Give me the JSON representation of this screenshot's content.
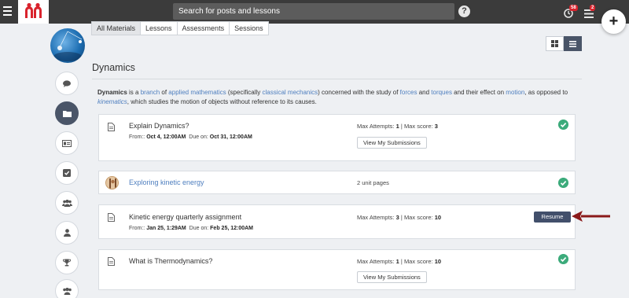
{
  "topbar": {
    "search_placeholder": "Search for posts and lessons",
    "help_glyph": "?",
    "notif_badge": "58",
    "list_badge": "2",
    "add_glyph": "+"
  },
  "tabs": [
    "All Materials",
    "Lessons",
    "Assessments",
    "Sessions"
  ],
  "folder": {
    "title": "Dynamics",
    "description": {
      "term": "Dynamics",
      "p1": " is a ",
      "l1": "branch",
      "p2": " of ",
      "l2": "applied mathematics",
      "p3": " (specifically ",
      "l3": "classical mechanics",
      "p4": ") concerned with the study of ",
      "l4": "forces",
      "p5": " and ",
      "l5": "torques",
      "p6": " and their effect on ",
      "l6": "motion",
      "p7": ", as opposed to ",
      "l7": "kinematics",
      "p8": ", which studies the motion of objects without reference to its causes."
    }
  },
  "materials": [
    {
      "title": "Explain Dynamics?",
      "from_label": "From::",
      "from": "Oct 4, 12:00AM",
      "due_label": "Due on:",
      "due": "Oct 31, 12:00AM",
      "attempts_label": "Max Attempts:",
      "attempts": "1",
      "sep": "|",
      "score_label": "Max score:",
      "score": "3",
      "button": "View My Submissions",
      "status": "complete"
    },
    {
      "title": "Exploring kinetic energy",
      "meta": "2 unit pages",
      "status": "complete"
    },
    {
      "title": "Kinetic energy quarterly assignment",
      "from_label": "From::",
      "from": "Jan 25, 1:29AM",
      "due_label": "Due on:",
      "due": "Feb 25, 12:00AM",
      "attempts_label": "Max Attempts:",
      "attempts": "3",
      "sep": "|",
      "score_label": "Max score:",
      "score": "10",
      "button": "Resume",
      "status": "in-progress"
    },
    {
      "title": "What is Thermodynamics?",
      "attempts_label": "Max Attempts:",
      "attempts": "1",
      "sep": "|",
      "score_label": "Max score:",
      "score": "10",
      "button": "View My Submissions",
      "status": "complete"
    }
  ],
  "colors": {
    "topbar": "#3b3b3b",
    "brand_red": "#d9232d",
    "link": "#4f7fbf",
    "check_green": "#3cab7b",
    "resume_button": "#424f6b",
    "annotation_arrow": "#8b1a1a"
  }
}
